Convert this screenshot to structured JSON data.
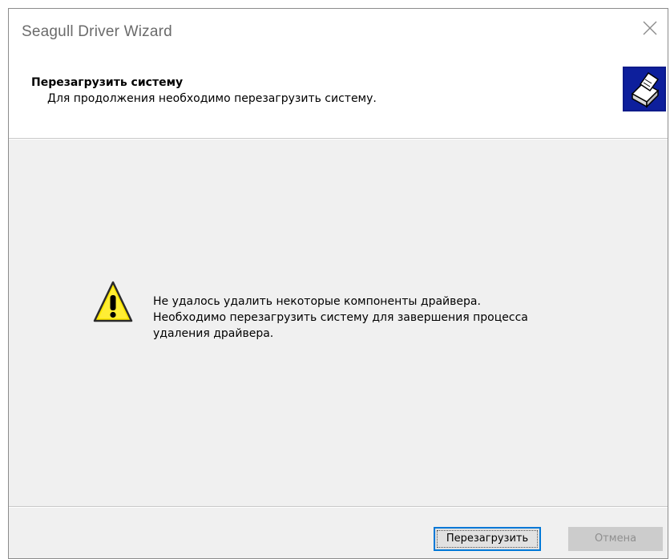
{
  "window": {
    "title": "Seagull Driver Wizard"
  },
  "header": {
    "title": "Перезагрузить систему",
    "subtitle": "Для продолжения необходимо перезагрузить систему."
  },
  "message": {
    "lines": [
      "Не удалось удалить некоторые компоненты драйвера.",
      "Необходимо перезагрузить систему для завершения процесса",
      "удаления драйвера."
    ]
  },
  "buttons": {
    "restart_label": "Перезагрузить",
    "cancel_label": "Отмена"
  },
  "icons": {
    "close": "close-icon",
    "wizard": "printer-wizard-icon",
    "warning": "warning-icon"
  },
  "colors": {
    "focus_border": "#0078d7",
    "dialog_bg": "#f0f0f0",
    "warning_yellow": "#ffe700"
  }
}
